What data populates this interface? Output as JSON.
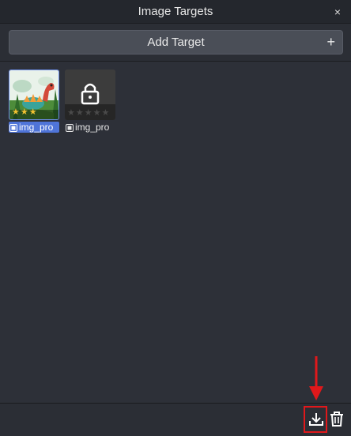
{
  "window": {
    "title": "Image Targets",
    "close_glyph": "×"
  },
  "toolbar": {
    "add_label": "Add Target",
    "add_glyph": "+"
  },
  "targets": [
    {
      "name": "img_pro",
      "rating": 3,
      "max_rating": 5,
      "locked": false,
      "selected": true,
      "icon": "dinosaur-thumbnail"
    },
    {
      "name": "img_pro",
      "rating": 0,
      "max_rating": 5,
      "locked": true,
      "selected": false,
      "icon": "lock-icon"
    }
  ],
  "footer": {
    "download_icon": "download-icon",
    "delete_icon": "trash-icon"
  },
  "colors": {
    "accent": "#4f74d8",
    "star": "#f1c232",
    "annotation": "#e0181b"
  }
}
